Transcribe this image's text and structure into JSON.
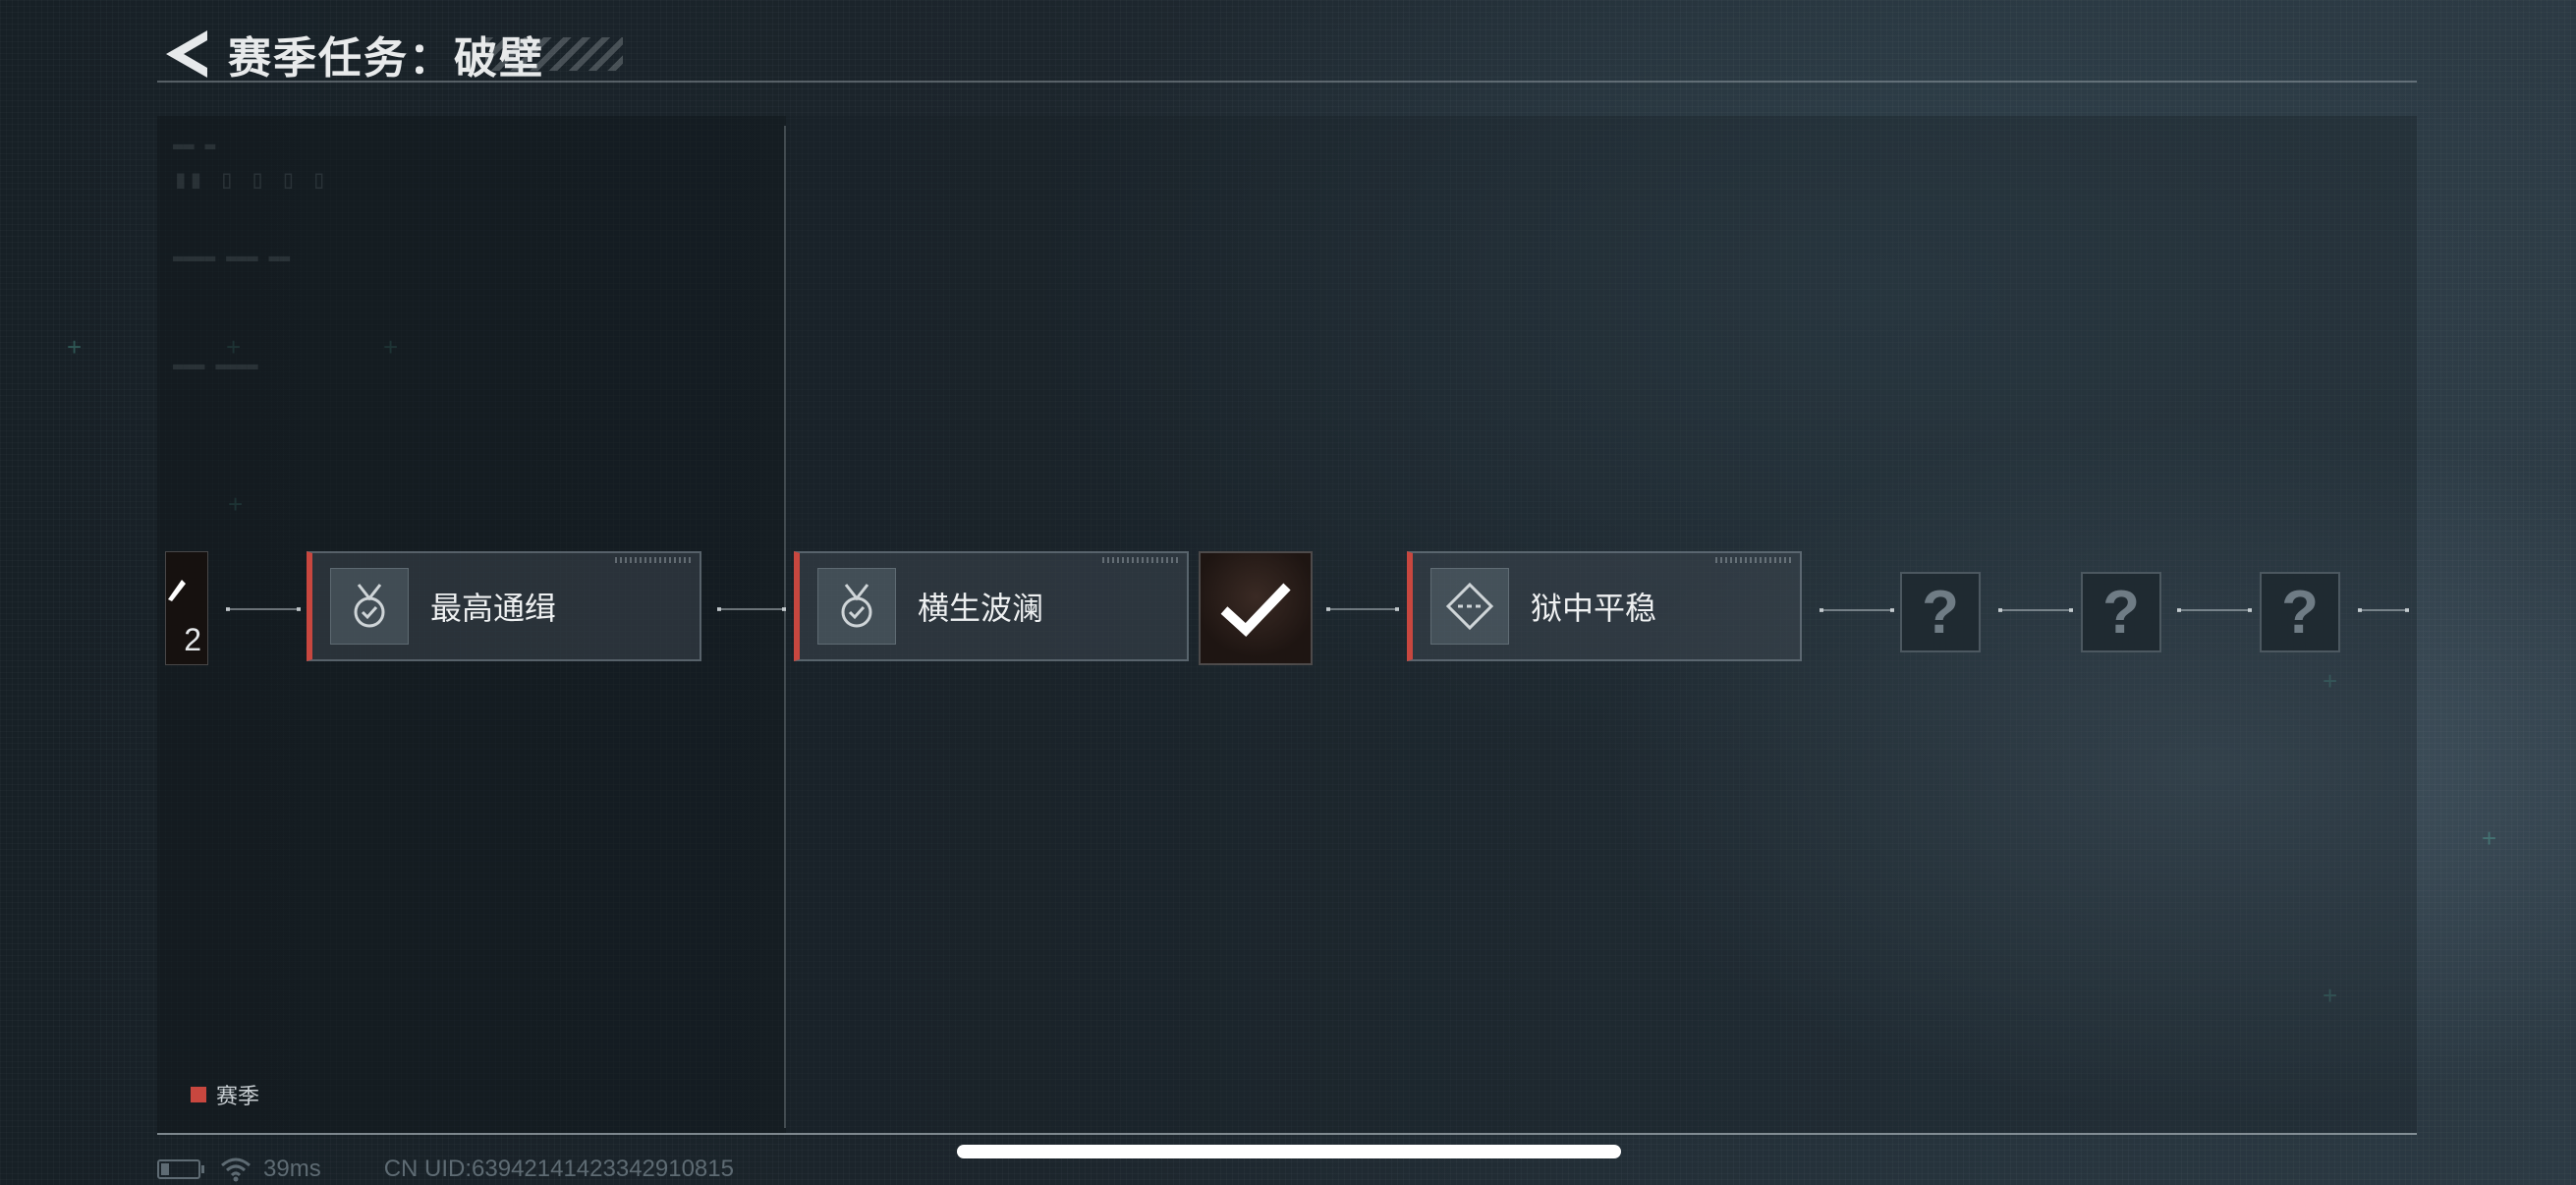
{
  "header": {
    "title": "赛季任务：破壁"
  },
  "track": {
    "left_tile_count": "2",
    "cards": [
      {
        "label": "最高通缉",
        "icon": "medal-check-icon"
      },
      {
        "label": "横生波澜",
        "icon": "medal-check-icon"
      },
      {
        "label": "狱中平稳",
        "icon": "diamond-dash-icon"
      }
    ],
    "reward_icon": "checkmark-icon",
    "mystery_glyph": "?"
  },
  "legend": {
    "label": "赛季",
    "color": "#c8473f"
  },
  "status": {
    "ping": "39ms",
    "uid": "CN UID:639421414233429108​15"
  }
}
